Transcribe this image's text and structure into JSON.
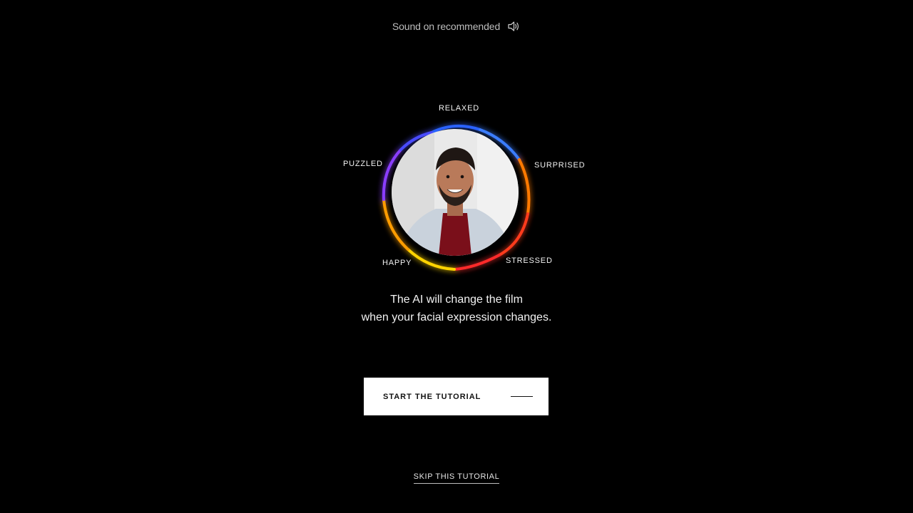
{
  "sound": {
    "text": "Sound on recommended",
    "icon": "speaker-icon"
  },
  "emotions": {
    "relaxed": "RELAXED",
    "puzzled": "PUZZLED",
    "surprised": "SURPRISED",
    "happy": "HAPPY",
    "stressed": "STRESSED"
  },
  "caption": {
    "line1": "The AI will change the film",
    "line2": "when your facial expression changes."
  },
  "start_button": {
    "label": "START THE TUTORIAL"
  },
  "skip_link": {
    "label": "SKIP THIS TUTORIAL"
  },
  "colors": {
    "background": "#000000",
    "button": "#ffffff",
    "ring": [
      "#2d6bff",
      "#7a3cff",
      "#ffd400",
      "#ff7a00",
      "#ff2a2a"
    ]
  }
}
